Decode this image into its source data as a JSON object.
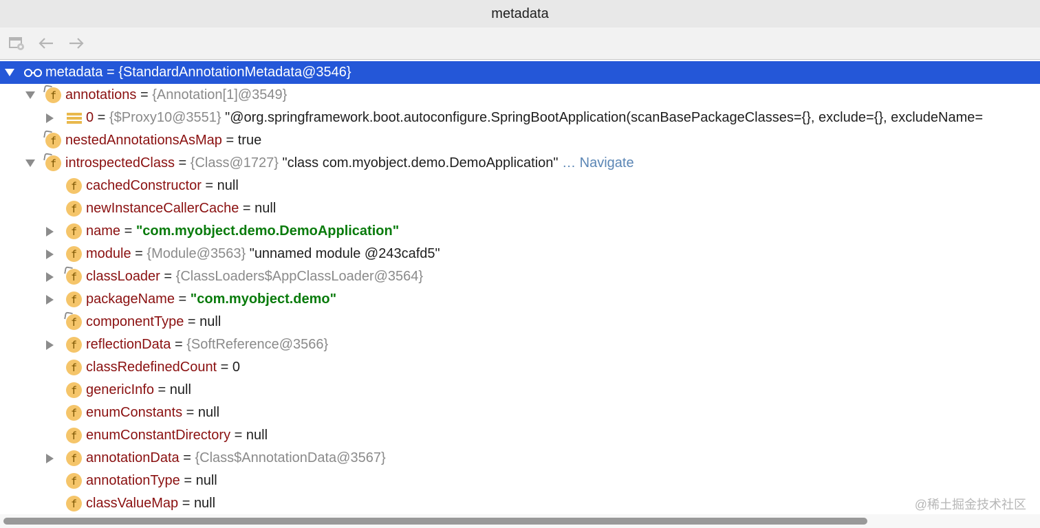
{
  "window": {
    "title": "metadata"
  },
  "toolbar": {
    "icons": [
      "watch-panel-icon",
      "back-arrow-icon",
      "forward-arrow-icon"
    ]
  },
  "tree": {
    "root": {
      "key": "metadata",
      "eq": " = ",
      "ref": "{StandardAnnotationMetadata@3546}"
    },
    "annotations": {
      "key": "annotations",
      "eq": " = ",
      "ref": "{Annotation[1]@3549}"
    },
    "item0": {
      "key": "0",
      "eq": " = ",
      "ref": "{$Proxy10@3551}",
      "value": " \"@org.springframework.boot.autoconfigure.SpringBootApplication(scanBasePackageClasses={}, exclude={}, excludeName="
    },
    "nestedAnnotationsAsMap": {
      "key": "nestedAnnotationsAsMap",
      "eq": " = ",
      "value": "true"
    },
    "introspectedClass": {
      "key": "introspectedClass",
      "eq": " = ",
      "ref": "{Class@1727}",
      "value": " \"class com.myobject.demo.DemoApplication\"",
      "link": " … Navigate"
    },
    "cachedConstructor": {
      "key": "cachedConstructor",
      "eq": " = ",
      "value": "null"
    },
    "newInstanceCallerCache": {
      "key": "newInstanceCallerCache",
      "eq": " = ",
      "value": "null"
    },
    "name": {
      "key": "name",
      "eq": " = ",
      "value": "\"com.myobject.demo.DemoApplication\""
    },
    "module": {
      "key": "module",
      "eq": " = ",
      "ref": "{Module@3563}",
      "value": " \"unnamed module @243cafd5\""
    },
    "classLoader": {
      "key": "classLoader",
      "eq": " = ",
      "ref": "{ClassLoaders$AppClassLoader@3564}"
    },
    "packageName": {
      "key": "packageName",
      "eq": " = ",
      "value": "\"com.myobject.demo\""
    },
    "componentType": {
      "key": "componentType",
      "eq": " = ",
      "value": "null"
    },
    "reflectionData": {
      "key": "reflectionData",
      "eq": " = ",
      "ref": "{SoftReference@3566}"
    },
    "classRedefinedCount": {
      "key": "classRedefinedCount",
      "eq": " = ",
      "value": "0"
    },
    "genericInfo": {
      "key": "genericInfo",
      "eq": " = ",
      "value": "null"
    },
    "enumConstants": {
      "key": "enumConstants",
      "eq": " = ",
      "value": "null"
    },
    "enumConstantDirectory": {
      "key": "enumConstantDirectory",
      "eq": " = ",
      "value": "null"
    },
    "annotationData": {
      "key": "annotationData",
      "eq": " = ",
      "ref": "{Class$AnnotationData@3567}"
    },
    "annotationType": {
      "key": "annotationType",
      "eq": " = ",
      "value": "null"
    },
    "classValueMap": {
      "key": "classValueMap",
      "eq": " = ",
      "value": "null"
    }
  },
  "field_icon_letter": "f",
  "watermark": "@稀土掘金技术社区",
  "colors": {
    "selection": "#2457d8",
    "field_name": "#8a1010",
    "string_value": "#097b0c",
    "link": "#5b86b5"
  }
}
